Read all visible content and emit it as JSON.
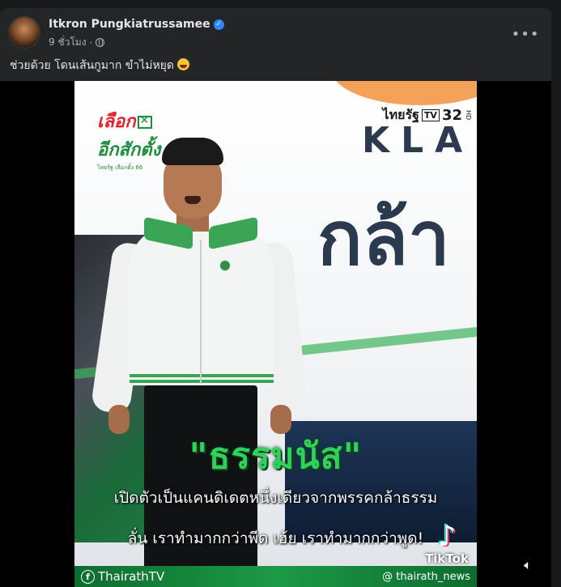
{
  "post": {
    "author": "Itkron Pungkiatrussamee",
    "time": "9 ชั่วโมง",
    "separator": "·",
    "more_label": "•••",
    "caption": "ช่วยด้วย โดนเส้นกูมาก ขำไม่หยุด",
    "caption_emoji": "laughing-emoji-icon"
  },
  "video": {
    "logo_left_line1": "เลือก",
    "logo_left_line2": "อีกสักตั้ง",
    "logo_left_line3": "ไทยรัฐ เลือกตั้ง 66",
    "logo_right_brand": "ไทยรัฐ",
    "logo_right_tv": "TV",
    "logo_right_num": "32",
    "logo_right_hd": "HD",
    "backdrop_text1": "KLA",
    "backdrop_text2": "กล้า",
    "title": "\"ธรรมนัส\"",
    "subtitle_line1": "เปิดตัวเป็นแคนดิเดตหนึ่งเดียวจากพรรคกล้าธรรม",
    "subtitle_line2": "ลั่น เราทำมากกว่าพีด เฮ้ย เราทำมากกว่าพูด!",
    "tiktok_label": "TikTok",
    "fb_handle": "ThairathTV",
    "tiktok_handle": "@ thairath_news"
  },
  "colors": {
    "card_bg": "#242526",
    "text_primary": "#e4e6eb",
    "text_secondary": "#b0b3b8",
    "verified_blue": "#2d88ff",
    "title_green": "#2fd15a",
    "bar_green": "#1c9a46"
  }
}
